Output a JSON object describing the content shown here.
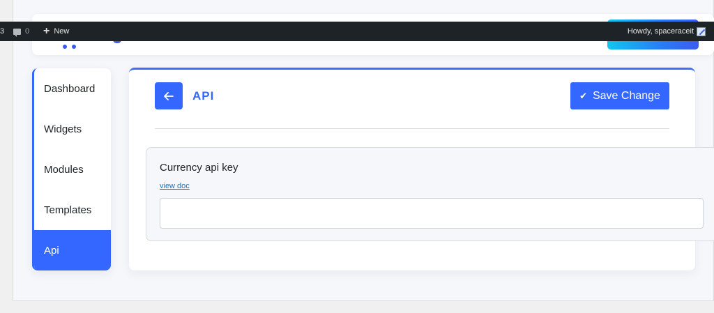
{
  "admin_bar": {
    "updates_count": "3",
    "comments_count": "0",
    "new_label": "New",
    "account_label": "Howdy, spaceraceit"
  },
  "sidebar": {
    "items": [
      {
        "label": "Dashboard",
        "active": false
      },
      {
        "label": "Widgets",
        "active": false
      },
      {
        "label": "Modules",
        "active": false
      },
      {
        "label": "Templates",
        "active": false
      },
      {
        "label": "Api",
        "active": true
      }
    ]
  },
  "main": {
    "title": "API",
    "save_label": "Save Change"
  },
  "api_setting": {
    "label": "Currency api key",
    "link_text": "view doc",
    "value": ""
  },
  "icons": {
    "back": "arrow-left-icon",
    "save": "check-icon",
    "comments": "comment-icon",
    "new": "plus-icon"
  },
  "colors": {
    "accent": "#3367ff",
    "admin_bar_bg": "#1d2327",
    "link": "#2271b1",
    "page_bg": "#f6f7fb"
  }
}
